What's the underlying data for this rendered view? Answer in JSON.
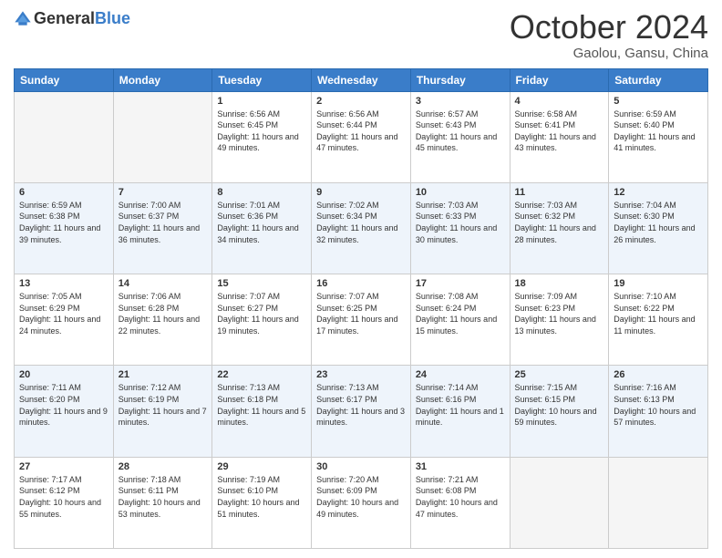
{
  "header": {
    "logo_general": "General",
    "logo_blue": "Blue",
    "month": "October 2024",
    "location": "Gaolou, Gansu, China"
  },
  "weekdays": [
    "Sunday",
    "Monday",
    "Tuesday",
    "Wednesday",
    "Thursday",
    "Friday",
    "Saturday"
  ],
  "weeks": [
    [
      {
        "day": "",
        "sunrise": "",
        "sunset": "",
        "daylight": ""
      },
      {
        "day": "",
        "sunrise": "",
        "sunset": "",
        "daylight": ""
      },
      {
        "day": "1",
        "sunrise": "Sunrise: 6:56 AM",
        "sunset": "Sunset: 6:45 PM",
        "daylight": "Daylight: 11 hours and 49 minutes."
      },
      {
        "day": "2",
        "sunrise": "Sunrise: 6:56 AM",
        "sunset": "Sunset: 6:44 PM",
        "daylight": "Daylight: 11 hours and 47 minutes."
      },
      {
        "day": "3",
        "sunrise": "Sunrise: 6:57 AM",
        "sunset": "Sunset: 6:43 PM",
        "daylight": "Daylight: 11 hours and 45 minutes."
      },
      {
        "day": "4",
        "sunrise": "Sunrise: 6:58 AM",
        "sunset": "Sunset: 6:41 PM",
        "daylight": "Daylight: 11 hours and 43 minutes."
      },
      {
        "day": "5",
        "sunrise": "Sunrise: 6:59 AM",
        "sunset": "Sunset: 6:40 PM",
        "daylight": "Daylight: 11 hours and 41 minutes."
      }
    ],
    [
      {
        "day": "6",
        "sunrise": "Sunrise: 6:59 AM",
        "sunset": "Sunset: 6:38 PM",
        "daylight": "Daylight: 11 hours and 39 minutes."
      },
      {
        "day": "7",
        "sunrise": "Sunrise: 7:00 AM",
        "sunset": "Sunset: 6:37 PM",
        "daylight": "Daylight: 11 hours and 36 minutes."
      },
      {
        "day": "8",
        "sunrise": "Sunrise: 7:01 AM",
        "sunset": "Sunset: 6:36 PM",
        "daylight": "Daylight: 11 hours and 34 minutes."
      },
      {
        "day": "9",
        "sunrise": "Sunrise: 7:02 AM",
        "sunset": "Sunset: 6:34 PM",
        "daylight": "Daylight: 11 hours and 32 minutes."
      },
      {
        "day": "10",
        "sunrise": "Sunrise: 7:03 AM",
        "sunset": "Sunset: 6:33 PM",
        "daylight": "Daylight: 11 hours and 30 minutes."
      },
      {
        "day": "11",
        "sunrise": "Sunrise: 7:03 AM",
        "sunset": "Sunset: 6:32 PM",
        "daylight": "Daylight: 11 hours and 28 minutes."
      },
      {
        "day": "12",
        "sunrise": "Sunrise: 7:04 AM",
        "sunset": "Sunset: 6:30 PM",
        "daylight": "Daylight: 11 hours and 26 minutes."
      }
    ],
    [
      {
        "day": "13",
        "sunrise": "Sunrise: 7:05 AM",
        "sunset": "Sunset: 6:29 PM",
        "daylight": "Daylight: 11 hours and 24 minutes."
      },
      {
        "day": "14",
        "sunrise": "Sunrise: 7:06 AM",
        "sunset": "Sunset: 6:28 PM",
        "daylight": "Daylight: 11 hours and 22 minutes."
      },
      {
        "day": "15",
        "sunrise": "Sunrise: 7:07 AM",
        "sunset": "Sunset: 6:27 PM",
        "daylight": "Daylight: 11 hours and 19 minutes."
      },
      {
        "day": "16",
        "sunrise": "Sunrise: 7:07 AM",
        "sunset": "Sunset: 6:25 PM",
        "daylight": "Daylight: 11 hours and 17 minutes."
      },
      {
        "day": "17",
        "sunrise": "Sunrise: 7:08 AM",
        "sunset": "Sunset: 6:24 PM",
        "daylight": "Daylight: 11 hours and 15 minutes."
      },
      {
        "day": "18",
        "sunrise": "Sunrise: 7:09 AM",
        "sunset": "Sunset: 6:23 PM",
        "daylight": "Daylight: 11 hours and 13 minutes."
      },
      {
        "day": "19",
        "sunrise": "Sunrise: 7:10 AM",
        "sunset": "Sunset: 6:22 PM",
        "daylight": "Daylight: 11 hours and 11 minutes."
      }
    ],
    [
      {
        "day": "20",
        "sunrise": "Sunrise: 7:11 AM",
        "sunset": "Sunset: 6:20 PM",
        "daylight": "Daylight: 11 hours and 9 minutes."
      },
      {
        "day": "21",
        "sunrise": "Sunrise: 7:12 AM",
        "sunset": "Sunset: 6:19 PM",
        "daylight": "Daylight: 11 hours and 7 minutes."
      },
      {
        "day": "22",
        "sunrise": "Sunrise: 7:13 AM",
        "sunset": "Sunset: 6:18 PM",
        "daylight": "Daylight: 11 hours and 5 minutes."
      },
      {
        "day": "23",
        "sunrise": "Sunrise: 7:13 AM",
        "sunset": "Sunset: 6:17 PM",
        "daylight": "Daylight: 11 hours and 3 minutes."
      },
      {
        "day": "24",
        "sunrise": "Sunrise: 7:14 AM",
        "sunset": "Sunset: 6:16 PM",
        "daylight": "Daylight: 11 hours and 1 minute."
      },
      {
        "day": "25",
        "sunrise": "Sunrise: 7:15 AM",
        "sunset": "Sunset: 6:15 PM",
        "daylight": "Daylight: 10 hours and 59 minutes."
      },
      {
        "day": "26",
        "sunrise": "Sunrise: 7:16 AM",
        "sunset": "Sunset: 6:13 PM",
        "daylight": "Daylight: 10 hours and 57 minutes."
      }
    ],
    [
      {
        "day": "27",
        "sunrise": "Sunrise: 7:17 AM",
        "sunset": "Sunset: 6:12 PM",
        "daylight": "Daylight: 10 hours and 55 minutes."
      },
      {
        "day": "28",
        "sunrise": "Sunrise: 7:18 AM",
        "sunset": "Sunset: 6:11 PM",
        "daylight": "Daylight: 10 hours and 53 minutes."
      },
      {
        "day": "29",
        "sunrise": "Sunrise: 7:19 AM",
        "sunset": "Sunset: 6:10 PM",
        "daylight": "Daylight: 10 hours and 51 minutes."
      },
      {
        "day": "30",
        "sunrise": "Sunrise: 7:20 AM",
        "sunset": "Sunset: 6:09 PM",
        "daylight": "Daylight: 10 hours and 49 minutes."
      },
      {
        "day": "31",
        "sunrise": "Sunrise: 7:21 AM",
        "sunset": "Sunset: 6:08 PM",
        "daylight": "Daylight: 10 hours and 47 minutes."
      },
      {
        "day": "",
        "sunrise": "",
        "sunset": "",
        "daylight": ""
      },
      {
        "day": "",
        "sunrise": "",
        "sunset": "",
        "daylight": ""
      }
    ]
  ]
}
